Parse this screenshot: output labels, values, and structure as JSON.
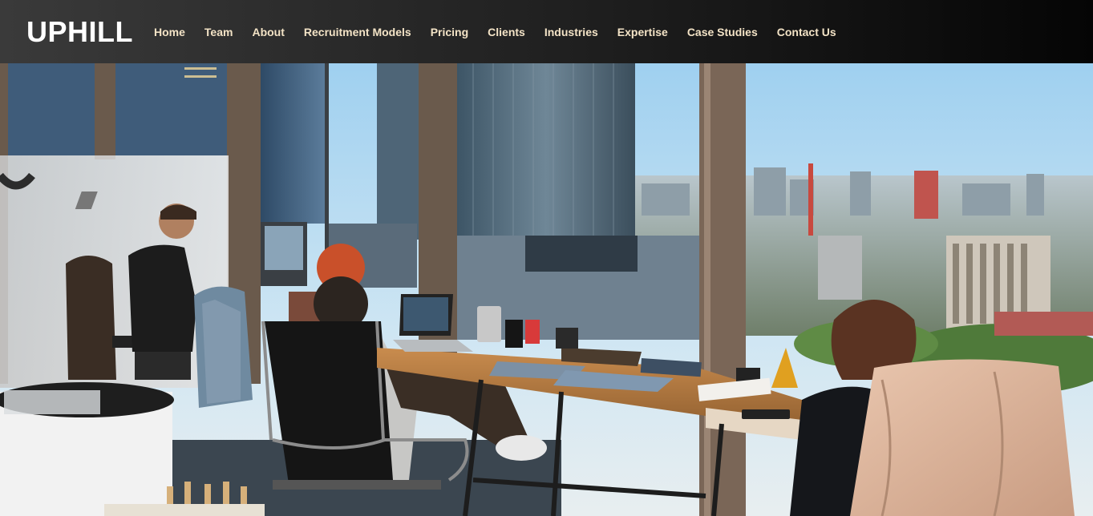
{
  "brand": {
    "name": "UPHILL"
  },
  "nav": {
    "items": [
      {
        "label": "Home"
      },
      {
        "label": "Team"
      },
      {
        "label": "About"
      },
      {
        "label": "Recruitment Models"
      },
      {
        "label": "Pricing"
      },
      {
        "label": "Clients"
      },
      {
        "label": "Industries"
      },
      {
        "label": "Expertise"
      },
      {
        "label": "Case Studies"
      },
      {
        "label": "Contact Us"
      }
    ]
  },
  "colors": {
    "nav_link": "#f3e3c6",
    "brand": "#ffffff",
    "nav_bg_start": "#3a3a3a",
    "nav_bg_end": "#050505"
  }
}
